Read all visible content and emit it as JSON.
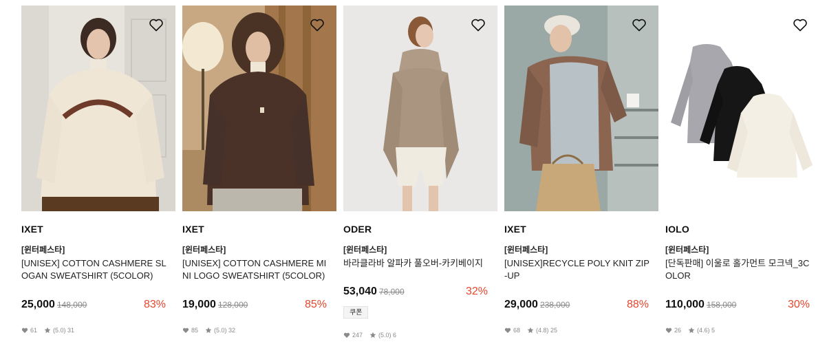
{
  "products": [
    {
      "brand": "IXET",
      "tag": "[윈터페스타]",
      "name": "[UNISEX] COTTON CASHMERE SLOGAN SWEATSHIRT (5COLOR)",
      "price": "25,000",
      "original_price": "148,000",
      "discount": "83%",
      "likes": "61",
      "rating": "(5.0) 31",
      "coupon": "",
      "image_desc": "person in cream slogan sweatshirt",
      "wish_icon": "heart-outline-icon"
    },
    {
      "brand": "IXET",
      "tag": "[윈터페스타]",
      "name": "[UNISEX] COTTON CASHMERE MINI LOGO SWEATSHIRT (5COLOR)",
      "price": "19,000",
      "original_price": "128,000",
      "discount": "85%",
      "likes": "85",
      "rating": "(5.0) 32",
      "coupon": "",
      "image_desc": "person in brown sweatshirt",
      "wish_icon": "heart-outline-icon"
    },
    {
      "brand": "ODER",
      "tag": "[윈터페스타]",
      "name": "바라클라바 알파카 풀오버-카키베이지",
      "price": "53,040",
      "original_price": "78,000",
      "discount": "32%",
      "likes": "247",
      "rating": "(5.0) 6",
      "coupon": "쿠폰",
      "image_desc": "person in beige balaclava pullover",
      "wish_icon": "heart-outline-icon"
    },
    {
      "brand": "IXET",
      "tag": "[윈터페스타]",
      "name": "[UNISEX]RECYCLE POLY KNIT ZIP-UP",
      "price": "29,000",
      "original_price": "238,000",
      "discount": "88%",
      "likes": "68",
      "rating": "(4.8) 25",
      "coupon": "",
      "image_desc": "person in brown knit zip-up with paper bag",
      "wish_icon": "heart-outline-icon"
    },
    {
      "brand": "IOLO",
      "tag": "[윈터페스타]",
      "name": "[단독판매] 이울로 홀가먼트 모크넥_3COLOR",
      "price": "110,000",
      "original_price": "158,000",
      "discount": "30%",
      "likes": "26",
      "rating": "(4.6) 5",
      "coupon": "",
      "image_desc": "three mock neck knits in grey, black, cream",
      "wish_icon": "heart-outline-icon"
    }
  ],
  "colors": {
    "discount": "#e8452c",
    "text": "#111111",
    "muted": "#888888"
  }
}
